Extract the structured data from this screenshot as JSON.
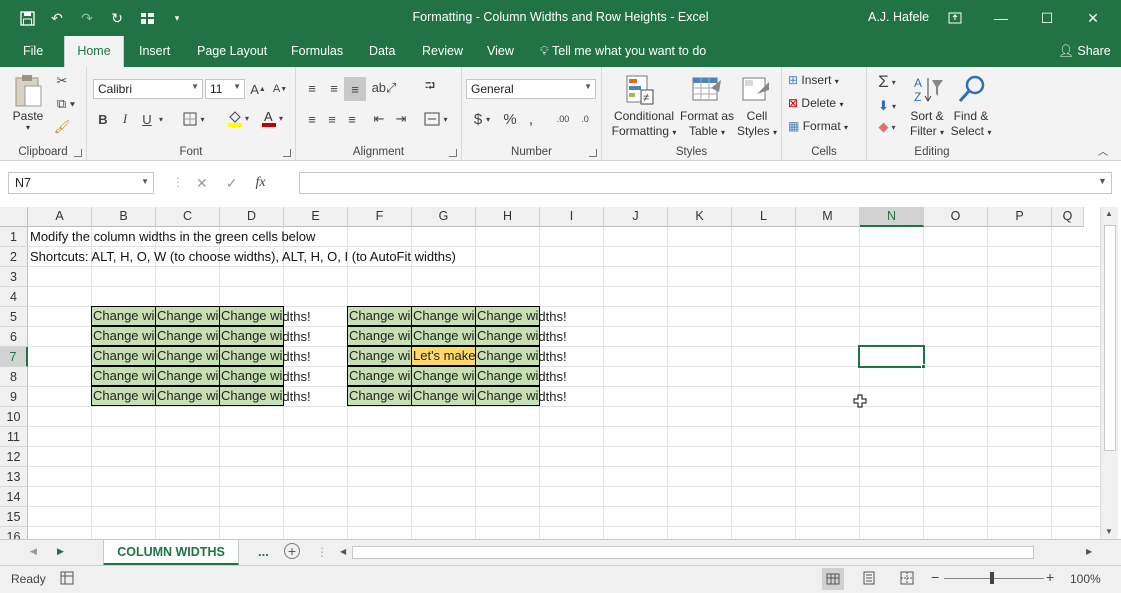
{
  "window": {
    "title": "Formatting - Column Widths and Row Heights  -  Excel",
    "user": "A.J. Hafele"
  },
  "ribbon_tabs": [
    "File",
    "Home",
    "Insert",
    "Page Layout",
    "Formulas",
    "Data",
    "Review",
    "View"
  ],
  "tell_me": "Tell me what you want to do",
  "share": "Share",
  "clipboard": {
    "paste": "Paste",
    "label": "Clipboard"
  },
  "font": {
    "name": "Calibri",
    "size": "11",
    "label": "Font",
    "bold": "B",
    "italic": "I",
    "underline": "U"
  },
  "alignment": {
    "label": "Alignment"
  },
  "number": {
    "format": "General",
    "label": "Number",
    "currency": "$",
    "percent": "%",
    "comma": ",",
    "inc_dec": ".00",
    "dec_dec": ".0"
  },
  "styles": {
    "conditional_1": "Conditional",
    "conditional_2": "Formatting",
    "format_table_1": "Format as",
    "format_table_2": "Table",
    "cell_styles_1": "Cell",
    "cell_styles_2": "Styles",
    "label": "Styles"
  },
  "cells": {
    "insert": "Insert",
    "delete": "Delete",
    "format": "Format",
    "label": "Cells"
  },
  "editing": {
    "sort_1": "Sort &",
    "sort_2": "Filter",
    "find_1": "Find &",
    "find_2": "Select",
    "label": "Editing"
  },
  "formula_bar": {
    "name_box": "N7",
    "fx": "fx",
    "value": ""
  },
  "columns": [
    "A",
    "B",
    "C",
    "D",
    "E",
    "F",
    "G",
    "H",
    "I",
    "J",
    "K",
    "L",
    "M",
    "N",
    "O",
    "P",
    "Q"
  ],
  "rows": [
    "1",
    "2",
    "3",
    "4",
    "5",
    "6",
    "7",
    "8",
    "9",
    "10",
    "11",
    "12",
    "13",
    "14",
    "15",
    "16"
  ],
  "cells_content": {
    "a1": "Modify the column widths in the green cells below",
    "a2": "Shortcuts: ALT, H, O, W (to choose widths), ALT, H, O, I (to AutoFit widths)",
    "green_text": "Change widths!",
    "yellow_text": "Let's make this wider!"
  },
  "sheet": {
    "active_tab": "COLUMN WIDTHS",
    "more": "..."
  },
  "status": {
    "ready": "Ready",
    "zoom": "100%"
  },
  "colors": {
    "excel_green": "#217346",
    "green_fill": "#c6e0b4",
    "yellow_fill": "#ffd966"
  }
}
